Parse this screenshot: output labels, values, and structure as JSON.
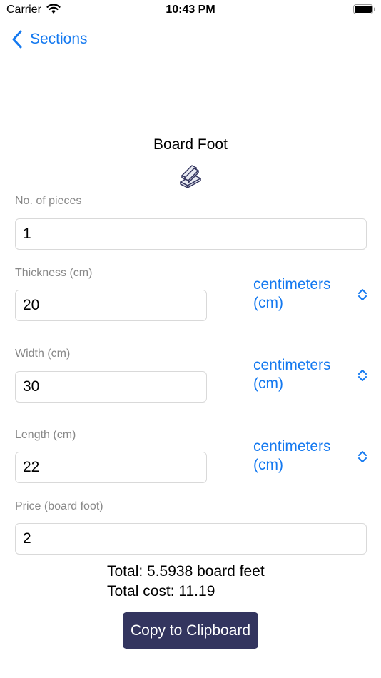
{
  "status_bar": {
    "carrier": "Carrier",
    "time": "10:43 PM"
  },
  "nav": {
    "back_label": "Sections"
  },
  "title": "Board Foot",
  "title_icon": "boards-icon",
  "fields": {
    "pieces": {
      "label": "No. of pieces",
      "value": "1"
    },
    "thickness": {
      "label": "Thickness (cm)",
      "value": "20",
      "unit": "centimeters (cm)"
    },
    "width": {
      "label": "Width (cm)",
      "value": "30",
      "unit": "centimeters (cm)"
    },
    "length": {
      "label": "Length (cm)",
      "value": "22",
      "unit": "centimeters (cm)"
    },
    "price": {
      "label": "Price (board foot)",
      "value": "2"
    }
  },
  "results": {
    "total": "Total: 5.5938 board feet",
    "total_cost": "Total cost: 11.19"
  },
  "copy_button_label": "Copy to Clipboard",
  "colors": {
    "accent": "#1479f0",
    "button": "#33355f",
    "label": "#888888"
  }
}
